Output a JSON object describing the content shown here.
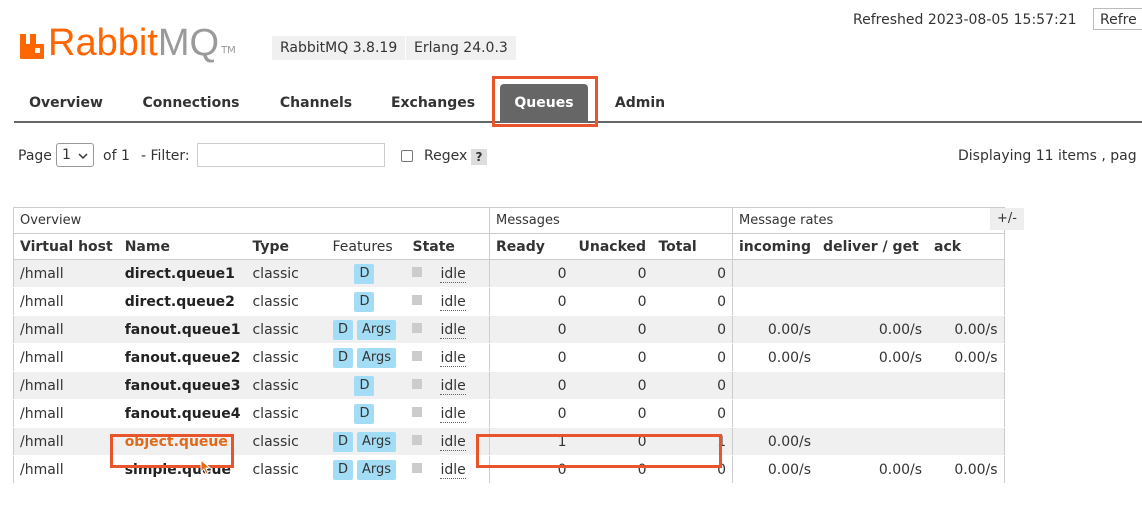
{
  "logo": {
    "brand_a": "Rabbit",
    "brand_b": "MQ",
    "tm": "TM"
  },
  "versions": {
    "rabbitmq": "RabbitMQ 3.8.19",
    "erlang": "Erlang 24.0.3"
  },
  "refreshed": "Refreshed 2023-08-05 15:57:21",
  "refresh_button": "Refre",
  "tabs": [
    "Overview",
    "Connections",
    "Channels",
    "Exchanges",
    "Queues",
    "Admin"
  ],
  "paging": {
    "page_label": "Page",
    "page_value": "1",
    "of_text": "of 1",
    "filter_label": "- Filter:",
    "filter_value": "",
    "regex_label": "Regex",
    "help": "?",
    "displaying": "Displaying 11 items , pag"
  },
  "table": {
    "groups": {
      "overview": "Overview",
      "messages": "Messages",
      "rates": "Message rates"
    },
    "toggle": "+/-",
    "headers": [
      "Virtual host",
      "Name",
      "Type",
      "Features",
      "State",
      "Ready",
      "Unacked",
      "Total",
      "incoming",
      "deliver / get",
      "ack"
    ],
    "rows": [
      {
        "vhost": "/hmall",
        "name": "direct.queue1",
        "type": "classic",
        "features": [
          "D"
        ],
        "state": "idle",
        "ready": "0",
        "unacked": "0",
        "total": "0",
        "incoming": "",
        "deliver": "",
        "ack": ""
      },
      {
        "vhost": "/hmall",
        "name": "direct.queue2",
        "type": "classic",
        "features": [
          "D"
        ],
        "state": "idle",
        "ready": "0",
        "unacked": "0",
        "total": "0",
        "incoming": "",
        "deliver": "",
        "ack": ""
      },
      {
        "vhost": "/hmall",
        "name": "fanout.queue1",
        "type": "classic",
        "features": [
          "D",
          "Args"
        ],
        "state": "idle",
        "ready": "0",
        "unacked": "0",
        "total": "0",
        "incoming": "0.00/s",
        "deliver": "0.00/s",
        "ack": "0.00/s"
      },
      {
        "vhost": "/hmall",
        "name": "fanout.queue2",
        "type": "classic",
        "features": [
          "D",
          "Args"
        ],
        "state": "idle",
        "ready": "0",
        "unacked": "0",
        "total": "0",
        "incoming": "0.00/s",
        "deliver": "0.00/s",
        "ack": "0.00/s"
      },
      {
        "vhost": "/hmall",
        "name": "fanout.queue3",
        "type": "classic",
        "features": [
          "D"
        ],
        "state": "idle",
        "ready": "0",
        "unacked": "0",
        "total": "0",
        "incoming": "",
        "deliver": "",
        "ack": ""
      },
      {
        "vhost": "/hmall",
        "name": "fanout.queue4",
        "type": "classic",
        "features": [
          "D"
        ],
        "state": "idle",
        "ready": "0",
        "unacked": "0",
        "total": "0",
        "incoming": "",
        "deliver": "",
        "ack": ""
      },
      {
        "vhost": "/hmall",
        "name": "object.queue",
        "type": "classic",
        "features": [
          "D",
          "Args"
        ],
        "state": "idle",
        "ready": "1",
        "unacked": "0",
        "total": "1",
        "incoming": "0.00/s",
        "deliver": "",
        "ack": ""
      },
      {
        "vhost": "/hmall",
        "name": "simple.queue",
        "type": "classic",
        "features": [
          "D",
          "Args"
        ],
        "state": "idle",
        "ready": "0",
        "unacked": "0",
        "total": "0",
        "incoming": "0.00/s",
        "deliver": "0.00/s",
        "ack": "0.00/s"
      }
    ]
  },
  "colors": {
    "brand": "#ff6600",
    "highlight": "#e8542c",
    "tab_active": "#666666",
    "feature_badge": "#a3ddf5"
  }
}
